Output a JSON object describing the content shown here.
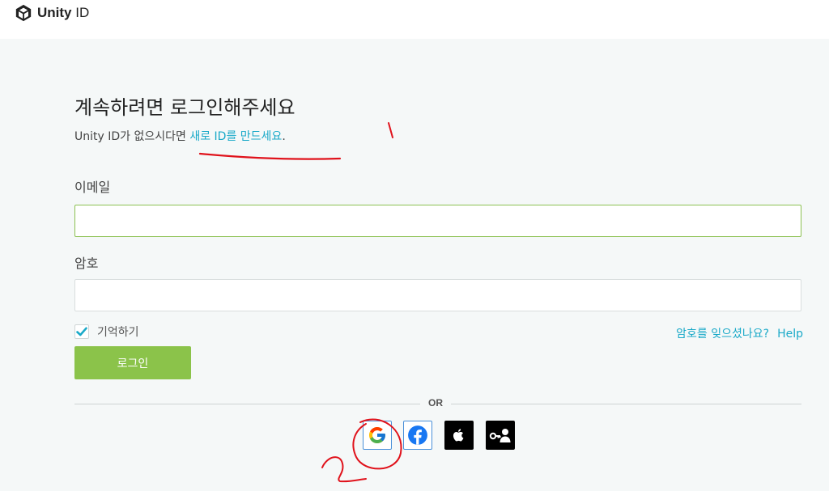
{
  "header": {
    "logo_bold": "Unity",
    "logo_light": "ID"
  },
  "login": {
    "heading": "계속하려면 로그인해주세요",
    "subtitle_prefix": "Unity ID가 없으시다면 ",
    "create_link": "새로 ID를 만드세요",
    "subtitle_suffix": ".",
    "email_label": "이메일",
    "email_value": "",
    "password_label": "암호",
    "password_value": "",
    "remember_label": "기억하기",
    "remember_checked": true,
    "forgot_link": "암호를 잊으셨나요?",
    "help_link": "Help",
    "login_button": "로그인",
    "or_text": "OR"
  },
  "social": {
    "providers": [
      "google-icon",
      "facebook-icon",
      "apple-icon",
      "sso-icon"
    ]
  },
  "colors": {
    "accent_link": "#19a9c8",
    "login_button": "#8bc34a",
    "focused_border": "#8cc152",
    "annotation": "#e0121b"
  }
}
